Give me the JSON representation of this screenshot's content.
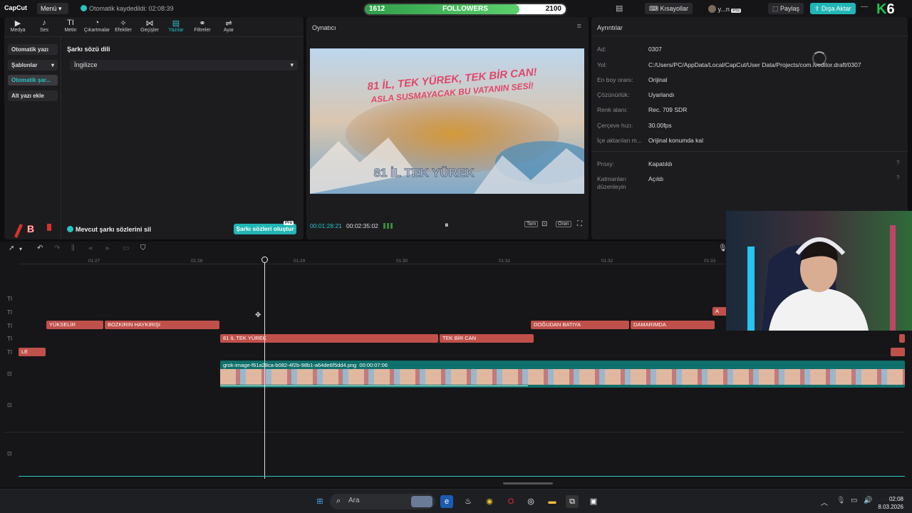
{
  "topbar": {
    "logo": "CapCut",
    "menu_label": "Menü",
    "autosave_text": "Otomatik kaydedildi: 02:08:39",
    "followers": {
      "current": "1612",
      "label": "FOLLOWERS",
      "goal": "2100",
      "progress_fraction": 0.77
    },
    "shortcuts_label": "Kısayollar",
    "user_label": "y...n",
    "share_label": "Paylaş",
    "export_label": "Dışa Aktar",
    "overlay_brand": "K6"
  },
  "toolbar": {
    "items": [
      {
        "label": "Medya",
        "icon": "media-icon"
      },
      {
        "label": "Ses",
        "icon": "audio-icon"
      },
      {
        "label": "Metin",
        "icon": "text-icon"
      },
      {
        "label": "Çıkartmalar",
        "icon": "sticker-icon"
      },
      {
        "label": "Efektler",
        "icon": "effects-icon"
      },
      {
        "label": "Geçişler",
        "icon": "transitions-icon"
      },
      {
        "label": "Yazılar",
        "icon": "captions-icon",
        "active": true
      },
      {
        "label": "Filtreler",
        "icon": "filters-icon"
      },
      {
        "label": "Ayar",
        "icon": "adjust-icon"
      }
    ]
  },
  "left_panel": {
    "sidebar": [
      "Otomatik yazı",
      "Şablonlar",
      "Otomatik şar...",
      "Alt yazı ekle"
    ],
    "title": "Şarkı sözü dili",
    "language": "İngilizce",
    "delete_existing_label": "Mevcut şarkı sözlerini sil",
    "generate_label": "Şarkı sözleri oluştur",
    "pro_badge": "Pro"
  },
  "player": {
    "title": "Oynatıcı",
    "overlay_line1": "81 İL, TEK YÜREK, TEK BİR CAN!",
    "overlay_line2": "ASLA SUSMAYACAK BU VATANIN SESİ!",
    "overlay_bottom": "81 İL TEK YÜREK",
    "timecode": "00:01:28:21",
    "duration": "00:02:35:02",
    "controls": [
      "Tam",
      "Oran"
    ]
  },
  "details": {
    "title": "Ayrıntılar",
    "rows": [
      {
        "label": "Ad:",
        "value": "0307"
      },
      {
        "label": "Yol:",
        "value": "C:/Users/PC/AppData/Local/CapCut/User Data/Projects/com.lveditor.draft/0307"
      },
      {
        "label": "En boy oranı:",
        "value": "Orijinal"
      },
      {
        "label": "Çözünürlük:",
        "value": "Uyarlandı"
      },
      {
        "label": "Renk alanı:",
        "value": "Rec. 709 SDR"
      },
      {
        "label": "Çerçeve hızı:",
        "value": "30.00fps"
      },
      {
        "label": "İçe aktarılan m...",
        "value": "Orijinal konumda kal"
      }
    ],
    "proxy_label": "Proxy:",
    "proxy_value": "Kapatıldı",
    "layers_label": "Katmanları düzenleyin",
    "layers_value": "Açıldı"
  },
  "timeline": {
    "ticks": [
      "01:27",
      "01:28",
      "01:29",
      "01:30",
      "01:31",
      "01:32",
      "01:33"
    ],
    "clips_row1": [
      "YÜKSELİR",
      "BOZKIRIN HAYKIRIŞI",
      "DOĞUDAN BATIYA",
      "DAMARIMDA"
    ],
    "clips_row2": [
      "81 İL TEK YÜREK",
      "TEK BİR CAN"
    ],
    "clip_row3": "LE",
    "video_clip_name": "grok-image-f61a28ca-b082-4f2b-98b1-a64de6f5dd4.png",
    "video_clip_duration": "00:00:07:06",
    "track_labels": [
      "TI",
      "TI",
      "TI",
      "TI",
      "TI"
    ]
  },
  "taskbar": {
    "search_placeholder": "Ara",
    "time": "02:08",
    "date": "8.03.2026"
  }
}
